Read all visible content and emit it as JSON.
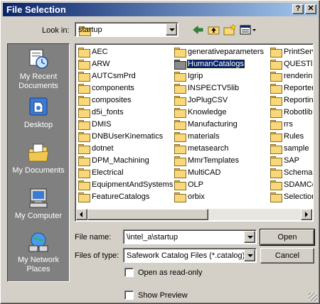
{
  "window": {
    "title": "File Selection",
    "help_glyph": "?",
    "close_glyph": "✕"
  },
  "lookin": {
    "label": "Look in:",
    "value": "startup"
  },
  "toolbar": {
    "icons": [
      "back-arrow-icon",
      "up-folder-icon",
      "new-folder-icon",
      "view-menu-icon"
    ]
  },
  "places": [
    {
      "label": "My Recent Documents",
      "icon": "recent-documents-icon"
    },
    {
      "label": "Desktop",
      "icon": "desktop-icon"
    },
    {
      "label": "My Documents",
      "icon": "my-documents-icon"
    },
    {
      "label": "My Computer",
      "icon": "my-computer-icon"
    },
    {
      "label": "My Network Places",
      "icon": "network-places-icon"
    }
  ],
  "files": {
    "col1": [
      "AEC",
      "ARW",
      "AUTCsmPrd",
      "components",
      "composites",
      "d5i_fonts",
      "DMIS",
      "DNBUserKinematics",
      "dotnet",
      "DPM_Machining",
      "Electrical",
      "EquipmentAndSystems",
      "FeatureCatalogs"
    ],
    "col2": [
      "generativeparameters",
      "HumanCatalogs",
      "Igrip",
      "INSPECTV5lib",
      "JoPlugCSV",
      "Knowledge",
      "Manufacturing",
      "materials",
      "metasearch",
      "MmrTemplates",
      "MultiCAD",
      "OLP",
      "orbix"
    ],
    "col3": [
      "PrintServ",
      "QUESTlib",
      "renderin(",
      "Reporter",
      "Reportin",
      "Robotlib",
      "rrs",
      "Rules",
      "sample",
      "SAP",
      "Schemas",
      "SDAMCor",
      "Selection"
    ],
    "selected": "HumanCatalogs"
  },
  "filename": {
    "label": "File name:",
    "value": "\\intel_a\\startup"
  },
  "filetype": {
    "label": "Files of type:",
    "value": "Safework Catalog Files (*.catalog)"
  },
  "buttons": {
    "open": "Open",
    "cancel": "Cancel"
  },
  "options": {
    "readonly_label": "Open as read-only",
    "preview_label": "Show Preview"
  },
  "colors": {
    "title_start": "#0a246a",
    "title_end": "#a6caf0",
    "face": "#d4d0c8",
    "places_bg": "#808080",
    "selection": "#0a246a"
  }
}
